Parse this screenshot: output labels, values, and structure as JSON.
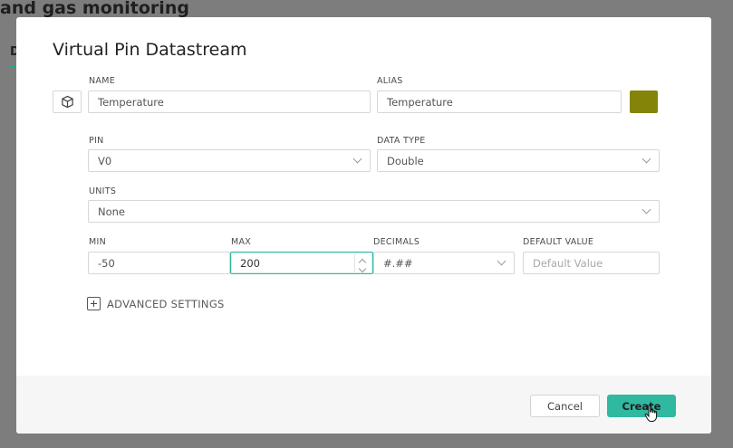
{
  "background": {
    "title": "and gas monitoring",
    "tab_label": "D"
  },
  "modal": {
    "title": "Virtual Pin Datastream",
    "icon": "cube-icon",
    "name": {
      "label": "NAME",
      "value": "Temperature"
    },
    "alias": {
      "label": "ALIAS",
      "value": "Temperature"
    },
    "color": "#848409",
    "pin": {
      "label": "PIN",
      "value": "V0"
    },
    "data_type": {
      "label": "DATA TYPE",
      "value": "Double"
    },
    "units": {
      "label": "UNITS",
      "value": "None"
    },
    "min": {
      "label": "MIN",
      "value": "-50"
    },
    "max": {
      "label": "MAX",
      "value": "200"
    },
    "decimals": {
      "label": "DECIMALS",
      "value": "#.##"
    },
    "default_value": {
      "label": "DEFAULT VALUE",
      "placeholder": "Default Value"
    },
    "advanced_settings_label": "ADVANCED SETTINGS",
    "cancel_label": "Cancel",
    "create_label": "Create"
  },
  "colors": {
    "accent": "#2fb9a0",
    "overlay": "#7d7d7d"
  }
}
